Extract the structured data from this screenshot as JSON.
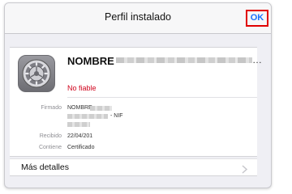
{
  "nav": {
    "title": "Perfil instalado",
    "ok_label": "OK"
  },
  "profile": {
    "icon": "settings-gear-icon",
    "name": "NOMBRE",
    "status": "No fiable"
  },
  "details": {
    "signed_label": "Firmado",
    "signed_value": "NOMBRE",
    "signed_nif": "- NIF",
    "received_label": "Recibido",
    "received_value": "22/04/201",
    "contains_label": "Contiene",
    "contains_value": "Certificado"
  },
  "more": {
    "label": "Más detalles",
    "chevron": "chevron-right-icon"
  },
  "colors": {
    "ok_highlight_border": "#e00000",
    "ok_text": "#1a73ff",
    "status_text": "#d0021b"
  }
}
